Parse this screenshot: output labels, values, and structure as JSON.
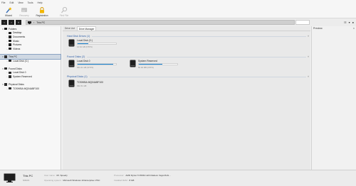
{
  "menu": [
    "File",
    "Edit",
    "View",
    "Tools",
    "Help"
  ],
  "ribbon": {
    "wizard": "Wizard",
    "recovery": "Recovery",
    "registration": "Registration",
    "find_file": "Find File"
  },
  "address": {
    "path_label": "This PC"
  },
  "tree": [
    {
      "label": "Folders",
      "level": 0,
      "icon": "folder",
      "arrow": "▾"
    },
    {
      "label": "Desktop",
      "level": 1,
      "icon": "folder",
      "arrow": "›"
    },
    {
      "label": "Documents",
      "level": 1,
      "icon": "folder",
      "arrow": "›"
    },
    {
      "label": "Music",
      "level": 1,
      "icon": "folder",
      "arrow": "›"
    },
    {
      "label": "Pictures",
      "level": 1,
      "icon": "folder",
      "arrow": "›"
    },
    {
      "label": "Videos",
      "level": 1,
      "icon": "folder",
      "arrow": "›"
    },
    {
      "label": "",
      "level": 0,
      "icon": "",
      "arrow": ""
    },
    {
      "label": "This PC",
      "level": 0,
      "icon": "drive",
      "arrow": "▾",
      "selected": true
    },
    {
      "label": "Local Disk (C:)",
      "level": 1,
      "icon": "drive",
      "arrow": "›"
    },
    {
      "label": "",
      "level": 0,
      "icon": "",
      "arrow": ""
    },
    {
      "label": "Found Disks",
      "level": 0,
      "icon": "drive",
      "arrow": "▾"
    },
    {
      "label": "Local Disk 0",
      "level": 1,
      "icon": "drive",
      "arrow": "›"
    },
    {
      "label": "System Reserved",
      "level": 1,
      "icon": "drive",
      "arrow": "›"
    },
    {
      "label": "",
      "level": 0,
      "icon": "",
      "arrow": ""
    },
    {
      "label": "Physical Disks",
      "level": 0,
      "icon": "drive",
      "arrow": "▾"
    },
    {
      "label": "TOSHIBA MQ04ABF100",
      "level": 1,
      "icon": "drive",
      "arrow": "›"
    }
  ],
  "tabs": [
    "Drive List",
    "Drive Manager"
  ],
  "sections": {
    "hard_disk_drives": "Hard Disk Drives (1)",
    "found_disks": "Found Disks (2)",
    "physical_disks": "Physical Disks (1)"
  },
  "disks": {
    "local_c": {
      "name": "Local Disk (C:)",
      "sub": "14.62 GB (NTFS)",
      "used_fraction": 0.28
    },
    "local_0": {
      "name": "Local Disk 0",
      "sub": "931.01 GB (NTFS)",
      "used_fraction": 0.93
    },
    "system_reserved": {
      "name": "System Reserved",
      "sub": "50.00 MB (NTFS)",
      "used_fraction": 0.62
    },
    "toshiba": {
      "name": "TOSHIBA MQ04ABF100",
      "sub": "931.51 GB"
    }
  },
  "preview": {
    "title": "Preview"
  },
  "status": {
    "title": "This PC",
    "subtitle": "NIRAN",
    "user_name_label": "User name:",
    "user_name": "Mr. Speedy",
    "os_label": "Operating system:",
    "os": "Microsoft Windows 10 Enterprise LTSC",
    "processor_label": "Processor:",
    "processor": "AMD Ryzen 5 3500U with Radeon Vega Mobi...",
    "memory_label": "Installed RAM:",
    "memory": "8 GB"
  },
  "colors": {
    "accent": "#1e88d6",
    "section_title": "#2f5fa8"
  }
}
